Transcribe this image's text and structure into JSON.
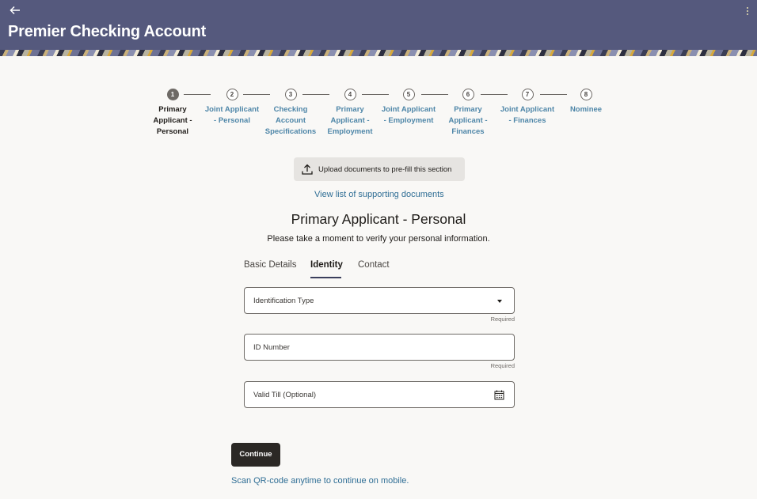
{
  "header": {
    "title": "Premier Checking Account",
    "back_icon": "arrow-left-icon",
    "menu_icon": "kebab-menu-icon",
    "bg_color": "#55597d"
  },
  "stepper": {
    "steps": [
      {
        "num": "1",
        "label_lines": [
          "Primary",
          "Applicant -",
          "Personal"
        ],
        "active": true
      },
      {
        "num": "2",
        "label_lines": [
          "Joint Applicant",
          "- Personal"
        ],
        "active": false
      },
      {
        "num": "3",
        "label_lines": [
          "Checking",
          "Account",
          "Specifications"
        ],
        "active": false
      },
      {
        "num": "4",
        "label_lines": [
          "Primary",
          "Applicant -",
          "Employment"
        ],
        "active": false
      },
      {
        "num": "5",
        "label_lines": [
          "Joint Applicant",
          "- Employment"
        ],
        "active": false
      },
      {
        "num": "6",
        "label_lines": [
          "Primary",
          "Applicant -",
          "Finances"
        ],
        "active": false
      },
      {
        "num": "7",
        "label_lines": [
          "Joint Applicant",
          "- Finances"
        ],
        "active": false
      },
      {
        "num": "8",
        "label_lines": [
          "Nominee"
        ],
        "active": false
      }
    ]
  },
  "upload": {
    "label": "Upload documents to pre-fill this section",
    "icon": "upload-icon"
  },
  "support_link": "View list of supporting documents",
  "section": {
    "title": "Primary Applicant - Personal",
    "subtitle": "Please take a moment to verify your personal information."
  },
  "tabs": [
    {
      "label": "Basic Details",
      "active": false
    },
    {
      "label": "Identity",
      "active": true
    },
    {
      "label": "Contact",
      "active": false
    }
  ],
  "form": {
    "identification_type": {
      "label": "Identification Type",
      "helper": "Required",
      "icon": "dropdown-caret-icon"
    },
    "id_number": {
      "label": "ID Number",
      "helper": "Required"
    },
    "valid_till": {
      "label": "Valid Till (Optional)",
      "icon": "calendar-icon"
    }
  },
  "continue_label": "Continue",
  "qr_text": "Scan QR-code anytime to continue on mobile.",
  "colors": {
    "accent_link": "#2f6e95",
    "primary_button": "#2b2825"
  }
}
